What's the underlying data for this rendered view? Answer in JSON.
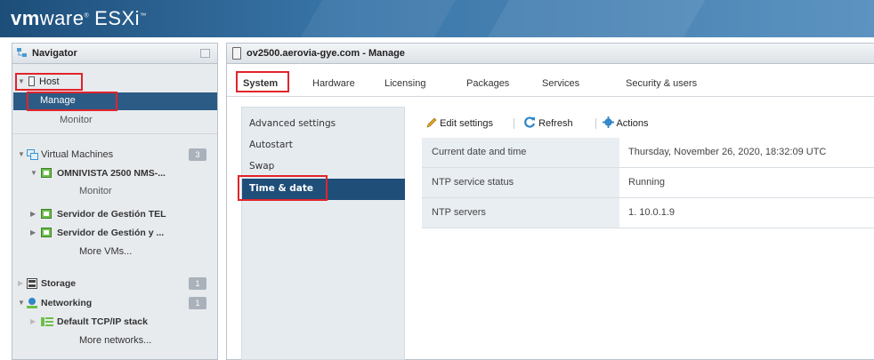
{
  "brand": {
    "vm": "vm",
    "ware": "ware",
    "product": "ESXi"
  },
  "navigator": {
    "title": "Navigator",
    "host": {
      "label": "Host",
      "manage": "Manage",
      "monitor": "Monitor"
    },
    "virtual_machines": {
      "label": "Virtual Machines",
      "count": "3",
      "items": [
        {
          "label": "OMNIVISTA 2500 NMS-...",
          "child": "Monitor"
        },
        {
          "label": "Servidor de Gestión TEL"
        },
        {
          "label": "Servidor de Gestión y ..."
        }
      ],
      "more": "More VMs..."
    },
    "storage": {
      "label": "Storage",
      "count": "1"
    },
    "networking": {
      "label": "Networking",
      "count": "1",
      "child": "Default TCP/IP stack",
      "more": "More networks..."
    }
  },
  "main": {
    "title": "ov2500.aerovia-gye.com - Manage",
    "tabs": [
      "System",
      "Hardware",
      "Licensing",
      "Packages",
      "Services",
      "Security & users"
    ],
    "active_tab": "System",
    "left_menu": [
      "Advanced settings",
      "Autostart",
      "Swap",
      "Time & date"
    ],
    "selected_menu": "Time & date",
    "toolbar": {
      "edit": "Edit settings",
      "refresh": "Refresh",
      "actions": "Actions"
    },
    "rows": [
      {
        "key": "Current date and time",
        "value": "Thursday, November 26, 2020, 18:32:09 UTC"
      },
      {
        "key": "NTP service status",
        "value": "Running"
      },
      {
        "key": "NTP servers",
        "value": "1. 10.0.1.9"
      }
    ]
  },
  "colors": {
    "highlight": "#e0252b",
    "selection": "#2c5b86",
    "brand_bar": "#3a76a9"
  }
}
